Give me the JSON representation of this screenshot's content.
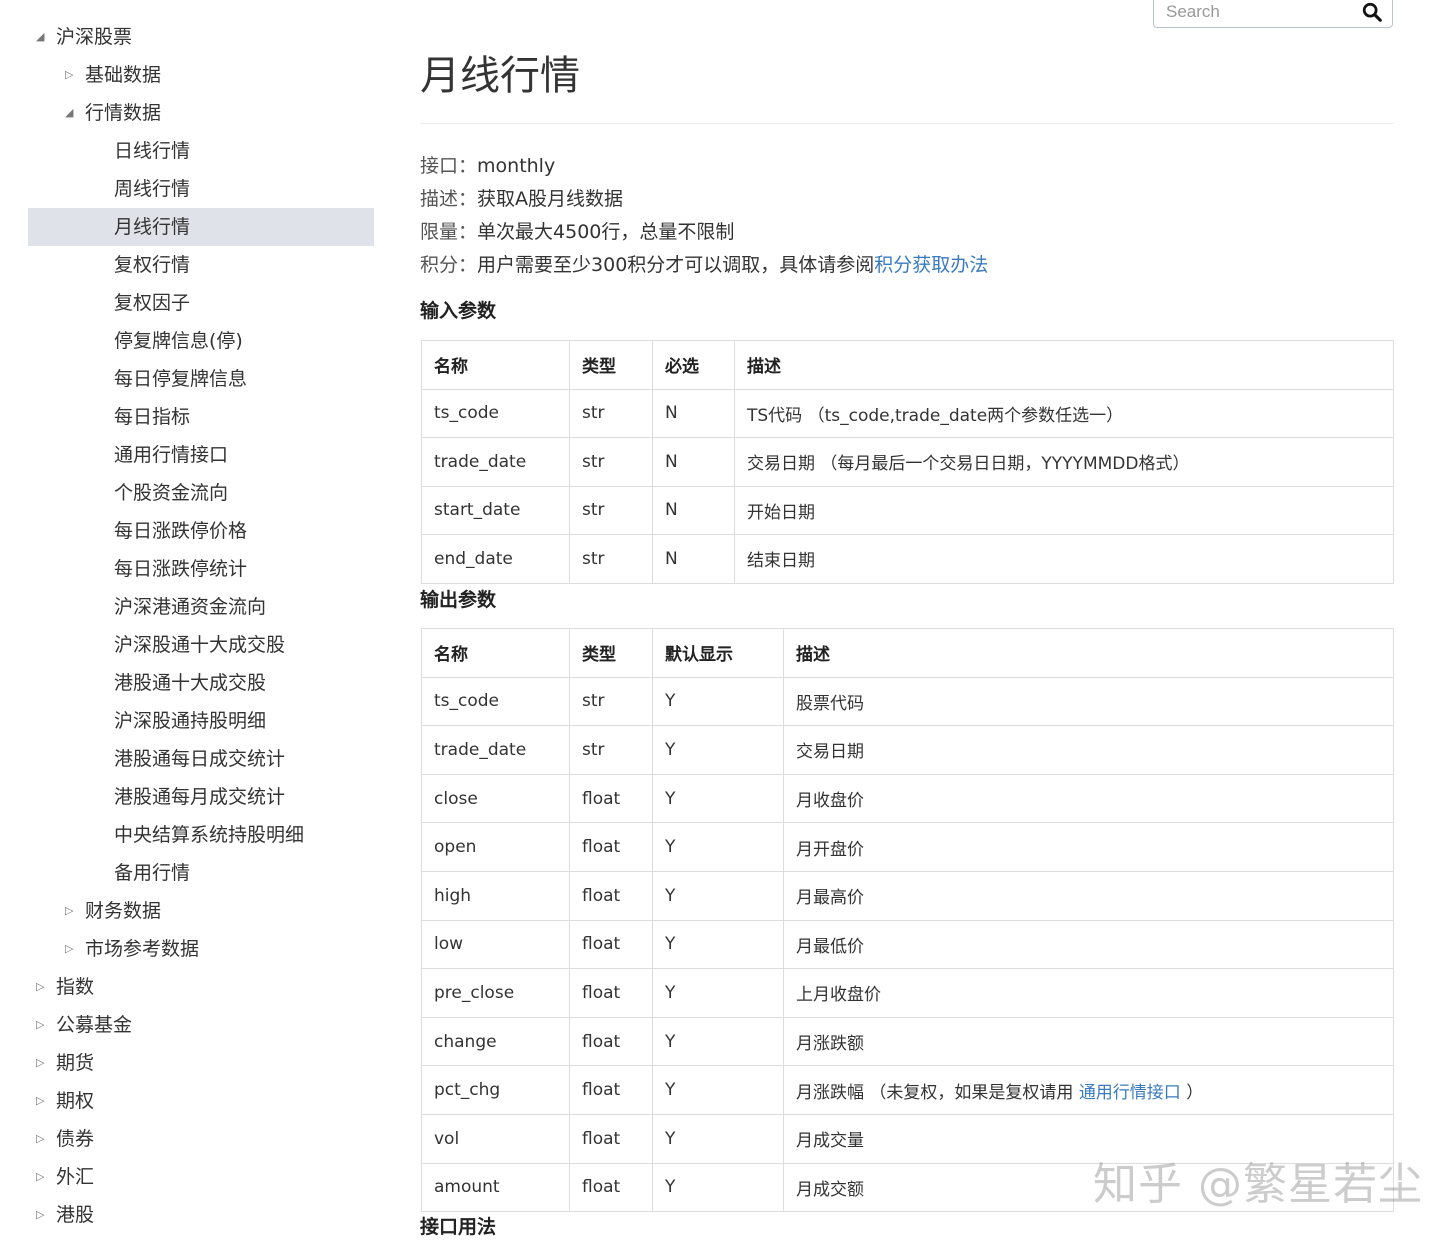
{
  "search": {
    "placeholder": "Search"
  },
  "sidebar": {
    "items": [
      {
        "label": "沪深股票",
        "level": 1,
        "state": "expanded",
        "active": false
      },
      {
        "label": "基础数据",
        "level": 2,
        "state": "collapsed",
        "active": false
      },
      {
        "label": "行情数据",
        "level": 2,
        "state": "expanded",
        "active": false
      },
      {
        "label": "日线行情",
        "level": 3,
        "active": false
      },
      {
        "label": "周线行情",
        "level": 3,
        "active": false
      },
      {
        "label": "月线行情",
        "level": 3,
        "active": true
      },
      {
        "label": "复权行情",
        "level": 3,
        "active": false
      },
      {
        "label": "复权因子",
        "level": 3,
        "active": false
      },
      {
        "label": "停复牌信息(停)",
        "level": 3,
        "active": false
      },
      {
        "label": "每日停复牌信息",
        "level": 3,
        "active": false
      },
      {
        "label": "每日指标",
        "level": 3,
        "active": false
      },
      {
        "label": "通用行情接口",
        "level": 3,
        "active": false
      },
      {
        "label": "个股资金流向",
        "level": 3,
        "active": false
      },
      {
        "label": "每日涨跌停价格",
        "level": 3,
        "active": false
      },
      {
        "label": "每日涨跌停统计",
        "level": 3,
        "active": false
      },
      {
        "label": "沪深港通资金流向",
        "level": 3,
        "active": false
      },
      {
        "label": "沪深股通十大成交股",
        "level": 3,
        "active": false
      },
      {
        "label": "港股通十大成交股",
        "level": 3,
        "active": false
      },
      {
        "label": "沪深股通持股明细",
        "level": 3,
        "active": false
      },
      {
        "label": "港股通每日成交统计",
        "level": 3,
        "active": false
      },
      {
        "label": "港股通每月成交统计",
        "level": 3,
        "active": false
      },
      {
        "label": "中央结算系统持股明细",
        "level": 3,
        "active": false
      },
      {
        "label": "备用行情",
        "level": 3,
        "active": false
      },
      {
        "label": "财务数据",
        "level": 2,
        "state": "collapsed",
        "active": false
      },
      {
        "label": "市场参考数据",
        "level": 2,
        "state": "collapsed",
        "active": false
      },
      {
        "label": "指数",
        "level": 1,
        "state": "collapsed",
        "active": false
      },
      {
        "label": "公募基金",
        "level": 1,
        "state": "collapsed",
        "active": false
      },
      {
        "label": "期货",
        "level": 1,
        "state": "collapsed",
        "active": false
      },
      {
        "label": "期权",
        "level": 1,
        "state": "collapsed",
        "active": false
      },
      {
        "label": "债券",
        "level": 1,
        "state": "collapsed",
        "active": false
      },
      {
        "label": "外汇",
        "level": 1,
        "state": "collapsed",
        "active": false
      },
      {
        "label": "港股",
        "level": 1,
        "state": "collapsed",
        "active": false
      }
    ]
  },
  "main": {
    "title": "月线行情",
    "info": {
      "api_key": "接口：",
      "api_val": "monthly",
      "desc_key": "描述：",
      "desc_val": "获取A股月线数据",
      "limit_key": "限量：",
      "limit_val": "单次最大4500行，总量不限制",
      "points_key": "积分：",
      "points_val": "用户需要至少300积分才可以调取，具体请参阅",
      "points_link": "积分获取办法"
    },
    "input_heading": "输入参数",
    "input_table": {
      "headers": [
        "名称",
        "类型",
        "必选",
        "描述"
      ],
      "rows": [
        [
          "ts_code",
          "str",
          "N",
          "TS代码 （ts_code,trade_date两个参数任选一）"
        ],
        [
          "trade_date",
          "str",
          "N",
          "交易日期 （每月最后一个交易日日期，YYYYMMDD格式）"
        ],
        [
          "start_date",
          "str",
          "N",
          "开始日期"
        ],
        [
          "end_date",
          "str",
          "N",
          "结束日期"
        ]
      ]
    },
    "output_heading": "输出参数",
    "output_table": {
      "headers": [
        "名称",
        "类型",
        "默认显示",
        "描述"
      ],
      "rows": [
        [
          "ts_code",
          "str",
          "Y",
          "股票代码"
        ],
        [
          "trade_date",
          "str",
          "Y",
          "交易日期"
        ],
        [
          "close",
          "float",
          "Y",
          "月收盘价"
        ],
        [
          "open",
          "float",
          "Y",
          "月开盘价"
        ],
        [
          "high",
          "float",
          "Y",
          "月最高价"
        ],
        [
          "low",
          "float",
          "Y",
          "月最低价"
        ],
        [
          "pre_close",
          "float",
          "Y",
          "上月收盘价"
        ],
        [
          "change",
          "float",
          "Y",
          "月涨跌额"
        ],
        [
          "pct_chg",
          "float",
          "Y",
          "月涨跌幅 （未复权，如果是复权请用 "
        ],
        [
          "vol",
          "float",
          "Y",
          "月成交量"
        ],
        [
          "amount",
          "float",
          "Y",
          "月成交额"
        ]
      ],
      "pct_chg_link": "通用行情接口",
      "pct_chg_suffix": " ）"
    },
    "usage_heading": "接口用法"
  },
  "watermark": "知乎 @繁星若尘",
  "colors": {
    "link": "#3a7bbf",
    "active_bg": "#dfe3e9",
    "border": "#dddddd"
  }
}
